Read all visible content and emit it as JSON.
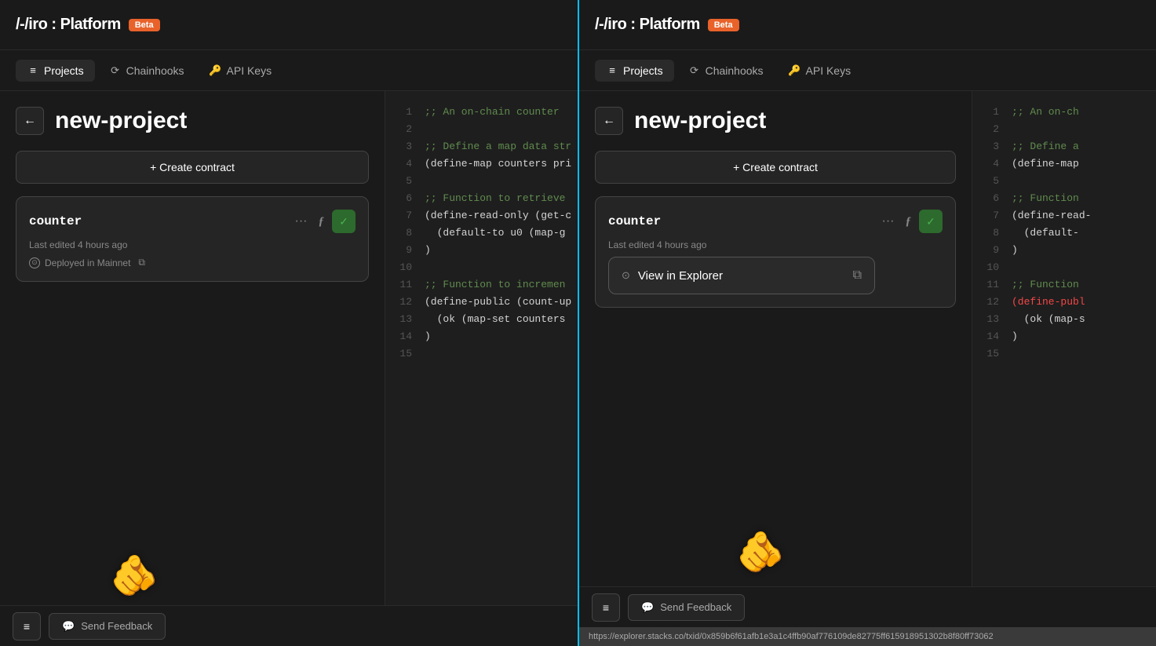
{
  "app": {
    "title": "/-/iro : Platform",
    "beta_label": "Beta"
  },
  "nav": {
    "items": [
      {
        "id": "projects",
        "label": "Projects",
        "icon": "≡",
        "active": true
      },
      {
        "id": "chainhooks",
        "label": "Chainhooks",
        "icon": "⟳"
      },
      {
        "id": "api-keys",
        "label": "API Keys",
        "icon": "🔑"
      }
    ]
  },
  "left": {
    "back_button": "←",
    "page_title": "new-project",
    "create_button": "+ Create contract",
    "contract": {
      "name": "counter",
      "meta": "Last edited 4 hours ago",
      "status": "Deployed in Mainnet",
      "check_icon": "✓",
      "dots": "···",
      "fn_label": "ƒ"
    }
  },
  "right": {
    "back_button": "←",
    "page_title": "new-project",
    "create_button": "+ Create contract",
    "contract": {
      "name": "counter",
      "meta": "Last edited 4 hours ago",
      "check_icon": "✓",
      "dots": "···",
      "fn_label": "ƒ"
    },
    "popup": {
      "deployed_icon": "⊙",
      "view_in_explorer": "View in Explorer",
      "ext_icon": "⧉"
    },
    "url_bar": "https://explorer.stacks.co/txid/0x859b6f61afb1e3a1c4ffb90af776109de82775ff615918951302b8f80ff73062"
  },
  "code": {
    "lines": [
      {
        "num": "1",
        "text": ";; An on-chain counter",
        "class": "c-comment"
      },
      {
        "num": "2",
        "text": "",
        "class": ""
      },
      {
        "num": "3",
        "text": ";; Define a map data str",
        "class": "c-comment"
      },
      {
        "num": "4",
        "text": "(define-map counters pri",
        "class": "c-default"
      },
      {
        "num": "5",
        "text": "",
        "class": ""
      },
      {
        "num": "6",
        "text": ";; Function to retrieve",
        "class": "c-comment"
      },
      {
        "num": "7",
        "text": "(define-read-only (get-c",
        "class": "c-default"
      },
      {
        "num": "8",
        "text": "  (default-to u0 (map-g",
        "class": "c-default"
      },
      {
        "num": "9",
        "text": ")",
        "class": "c-default"
      },
      {
        "num": "10",
        "text": "",
        "class": ""
      },
      {
        "num": "11",
        "text": ";; Function to incremen",
        "class": "c-comment"
      },
      {
        "num": "12",
        "text": "(define-public (count-up",
        "class": "c-default"
      },
      {
        "num": "13",
        "text": "  (ok (map-set counters",
        "class": "c-default"
      },
      {
        "num": "14",
        "text": ")",
        "class": "c-default"
      },
      {
        "num": "15",
        "text": "",
        "class": ""
      }
    ]
  },
  "code_right": {
    "lines": [
      {
        "num": "1",
        "text": ";; An on-ch",
        "class": "c-comment"
      },
      {
        "num": "2",
        "text": "",
        "class": ""
      },
      {
        "num": "3",
        "text": ";; Define a",
        "class": "c-comment"
      },
      {
        "num": "4",
        "text": "(define-map ",
        "class": "c-default"
      },
      {
        "num": "5",
        "text": "",
        "class": ""
      },
      {
        "num": "6",
        "text": ";; Function",
        "class": "c-comment"
      },
      {
        "num": "7",
        "text": "(define-read-",
        "class": "c-default"
      },
      {
        "num": "8",
        "text": "  (default-",
        "class": "c-default"
      },
      {
        "num": "9",
        "text": ")",
        "class": "c-default"
      },
      {
        "num": "10",
        "text": "",
        "class": ""
      },
      {
        "num": "11",
        "text": ";; Function",
        "class": "c-comment"
      },
      {
        "num": "12",
        "text": "(define-publ",
        "class": "c-red"
      },
      {
        "num": "13",
        "text": "  (ok (map-s",
        "class": "c-default"
      },
      {
        "num": "14",
        "text": ")",
        "class": "c-default"
      },
      {
        "num": "15",
        "text": "",
        "class": ""
      }
    ]
  },
  "bottom": {
    "menu_icon": "≡",
    "feedback_icon": "💬",
    "feedback_label": "Send Feedback"
  }
}
